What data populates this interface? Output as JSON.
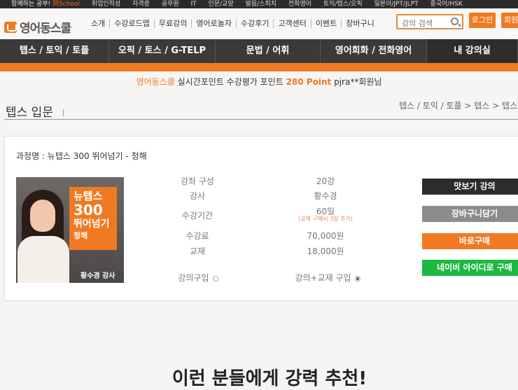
{
  "topbar": {
    "tagline_prefix": "함께하는 공부!",
    "tagline_brand": "同School",
    "links": [
      "취업인적성",
      "자격증",
      "공무원",
      "IT",
      "인문/교양",
      "발음/스피치",
      "전화영어",
      "토익/텝스/오픽",
      "일본어/JPT/JLPT",
      "중국어/HSK"
    ]
  },
  "header": {
    "logo_text": "영어동스쿨",
    "nav": [
      "소개",
      "수강로드맵",
      "무료강의",
      "영어로놀자",
      "수강후기",
      "고객센터",
      "이벤트",
      "장바구니"
    ],
    "search_placeholder": "강의 검색",
    "login_label": "로그인",
    "join_label": "회원가입"
  },
  "main_nav": {
    "tabs": [
      "텝스 / 토익 / 토플",
      "오픽 / 토스 / G-TELP",
      "문법 / 어휘",
      "영어회화 / 전화영어",
      "내 강의실"
    ]
  },
  "point_bar": {
    "brand": "영어동스쿨",
    "text": "실시간포인트 수강평가 포인트",
    "points": "280 Point",
    "user": "pjra**회원님"
  },
  "page": {
    "title": "텝스 입문",
    "breadcrumb": "텝스 / 토익 / 토플 > 텝스 > 텝스"
  },
  "course": {
    "name_label": "과정명 : 뉴텝스 300 뛰어넘기 - 청해",
    "cover": {
      "line1": "뉴텝스",
      "line2": "300",
      "line3": "뛰어넘기",
      "line4": "청해",
      "teacher": "황수경 강사"
    },
    "details": [
      {
        "key": "강좌 구성",
        "value": "20강"
      },
      {
        "key": "강사",
        "value": "황수경"
      },
      {
        "key": "수강기간",
        "value": "60일",
        "note": "(교재 구매시 3일 추가)"
      },
      {
        "key": "수강료",
        "value": "70,000원"
      },
      {
        "key": "교재",
        "value": "18,000원"
      }
    ],
    "options": {
      "lecture_only": "강의구입",
      "lecture_book": "강의+교재 구입",
      "selected": "강의+교재 구입"
    },
    "actions": {
      "preview": "맛보기 강의",
      "cart": "장바구니담기",
      "buy": "바로구매",
      "naver": "네이버 아이디로 구매"
    }
  },
  "recommend": {
    "heading": "이런 분들에게 강력 추천!"
  },
  "colors": {
    "accent": "#f07a22",
    "nav_dark": "#3a3a3a",
    "naver_green": "#1db83f"
  }
}
